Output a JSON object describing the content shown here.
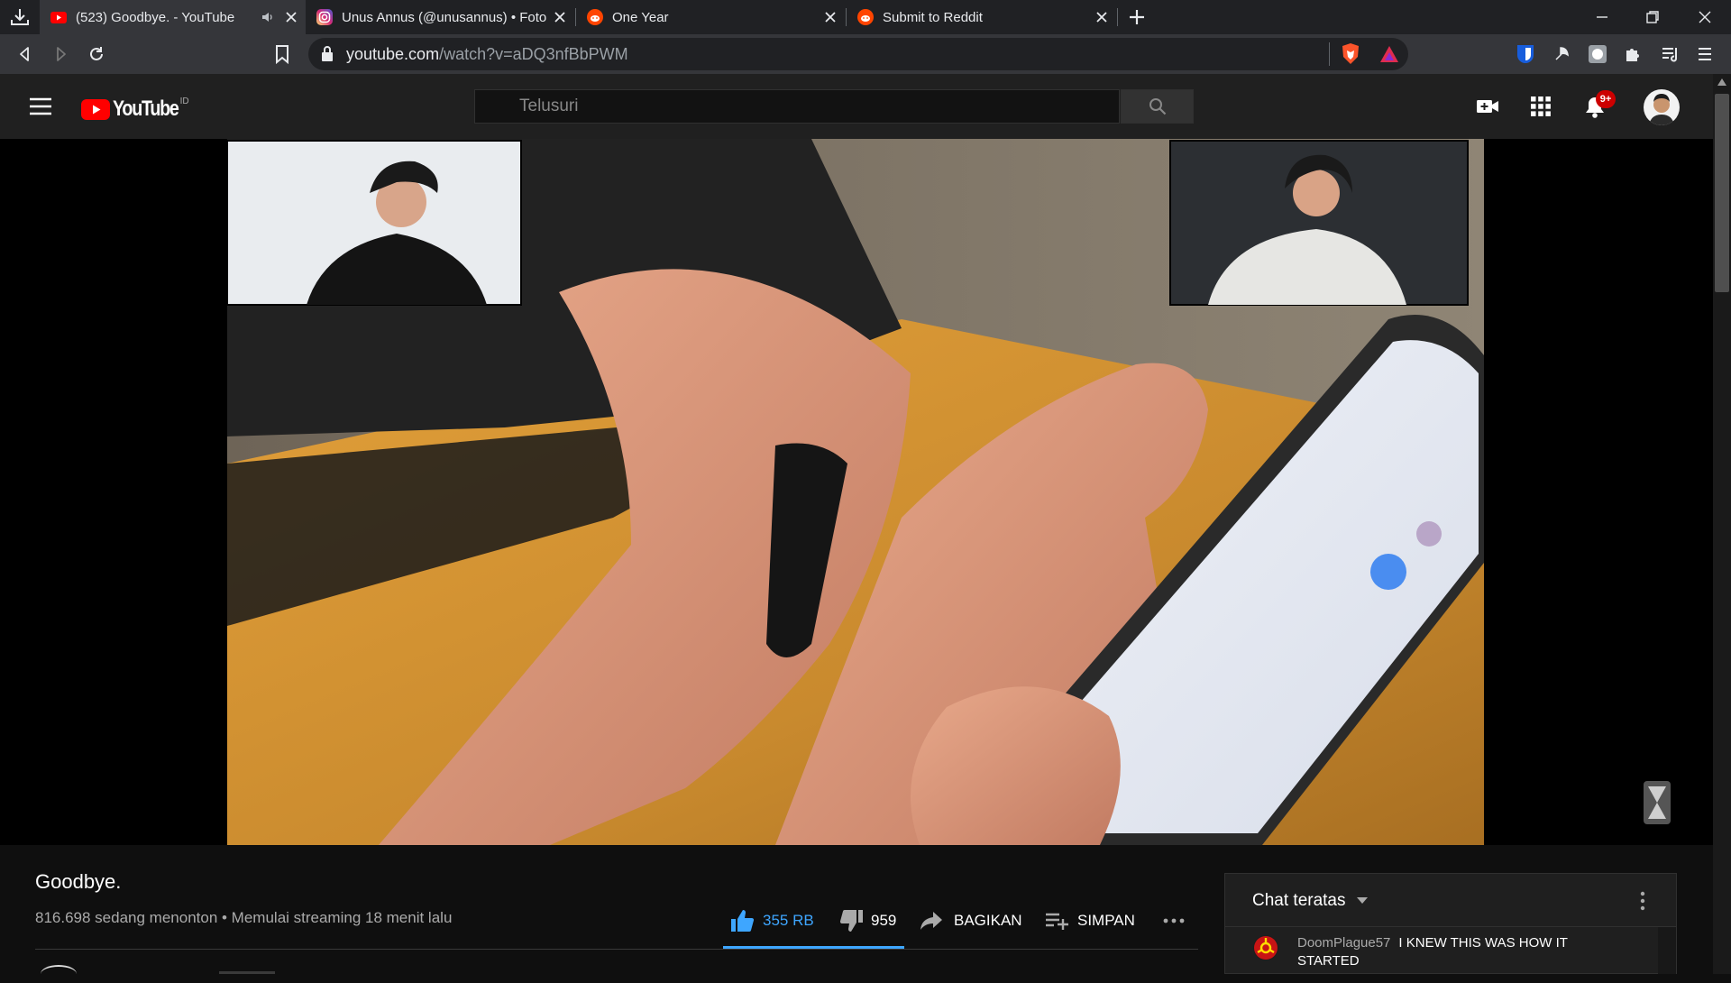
{
  "browser": {
    "tabs": [
      {
        "title": "(523) Goodbye. - YouTube",
        "favicon": "youtube-icon",
        "active": true,
        "audio": true
      },
      {
        "title": "Unus Annus (@unusannus) • Foto",
        "favicon": "instagram-icon",
        "active": false
      },
      {
        "title": "One Year",
        "favicon": "reddit-icon",
        "active": false
      },
      {
        "title": "Submit to Reddit",
        "favicon": "reddit-icon",
        "active": false
      }
    ],
    "url_host": "youtube.com",
    "url_path": "/watch?v=aDQ3nfBbPWM"
  },
  "youtube": {
    "logo_text": "YouTube",
    "country_code": "ID",
    "search_placeholder": "Telusuri",
    "notification_count": "9+"
  },
  "video": {
    "title": "Goodbye.",
    "meta": "816.698 sedang menonton • Memulai streaming 18 menit lalu",
    "actions": {
      "likes": "355 RB",
      "dislikes": "959",
      "share_label": "BAGIKAN",
      "save_label": "SIMPAN"
    }
  },
  "chat": {
    "mode_label": "Chat teratas",
    "messages": [
      {
        "author": "DoomPlague57",
        "line1": "I KNEW THIS WAS HOW IT",
        "line2": "STARTED"
      }
    ]
  },
  "colors": {
    "accent_blue": "#3ea6ff",
    "youtube_red": "#ff0000",
    "header_bg": "#202020",
    "browser_bg": "#202124"
  }
}
